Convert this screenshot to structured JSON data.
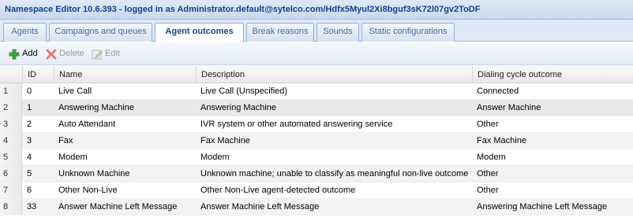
{
  "window": {
    "title": "Namespace Editor 10.6.393 - logged in as Administrator.default@sytelco.com/Hdfx5Myul2Xi8bguf3sK72l07gv2ToDF"
  },
  "tabs": [
    {
      "label": "Agents",
      "active": false
    },
    {
      "label": "Campaigns and queues",
      "active": false
    },
    {
      "label": "Agent outcomes",
      "active": true
    },
    {
      "label": "Break reasons",
      "active": false
    },
    {
      "label": "Sounds",
      "active": false
    },
    {
      "label": "Static configurations",
      "active": false
    }
  ],
  "toolbar": {
    "add_label": "Add",
    "delete_label": "Delete",
    "edit_label": "Edit",
    "add_icon": "green-plus-icon",
    "delete_icon": "red-x-icon",
    "edit_icon": "pencil-icon"
  },
  "grid": {
    "columns": [
      "ID",
      "Name",
      "Description",
      "Dialing cycle outcome"
    ],
    "rows": [
      {
        "num": "1",
        "id": "0",
        "name": "Live Call",
        "description": "Live Call (Unspecified)",
        "dialing_outcome": "Connected"
      },
      {
        "num": "2",
        "id": "1",
        "name": "Answering Machine",
        "description": "Answering Machine",
        "dialing_outcome": "Answer Machine"
      },
      {
        "num": "3",
        "id": "2",
        "name": "Auto Attendant",
        "description": "IVR system or other automated answering service",
        "dialing_outcome": "Other"
      },
      {
        "num": "4",
        "id": "3",
        "name": "Fax",
        "description": "Fax Machine",
        "dialing_outcome": "Fax Machine"
      },
      {
        "num": "5",
        "id": "4",
        "name": "Modem",
        "description": "Modem",
        "dialing_outcome": "Modem"
      },
      {
        "num": "6",
        "id": "5",
        "name": "Unknown Machine",
        "description": "Unknown machine; unable to classify as meaningful non-live outcome",
        "dialing_outcome": "Other"
      },
      {
        "num": "7",
        "id": "6",
        "name": "Other Non-Live",
        "description": "Other Non-Live agent-detected outcome",
        "dialing_outcome": "Other"
      },
      {
        "num": "8",
        "id": "33",
        "name": "Answer Machine Left Message",
        "description": "Answer Machine Left Message",
        "dialing_outcome": "Answering Machine Left Message"
      }
    ]
  },
  "colors": {
    "title_text": "#15428b",
    "tab_border": "#8db2e3",
    "add_green": "#2e9e2e",
    "delete_red": "#d9534f"
  }
}
